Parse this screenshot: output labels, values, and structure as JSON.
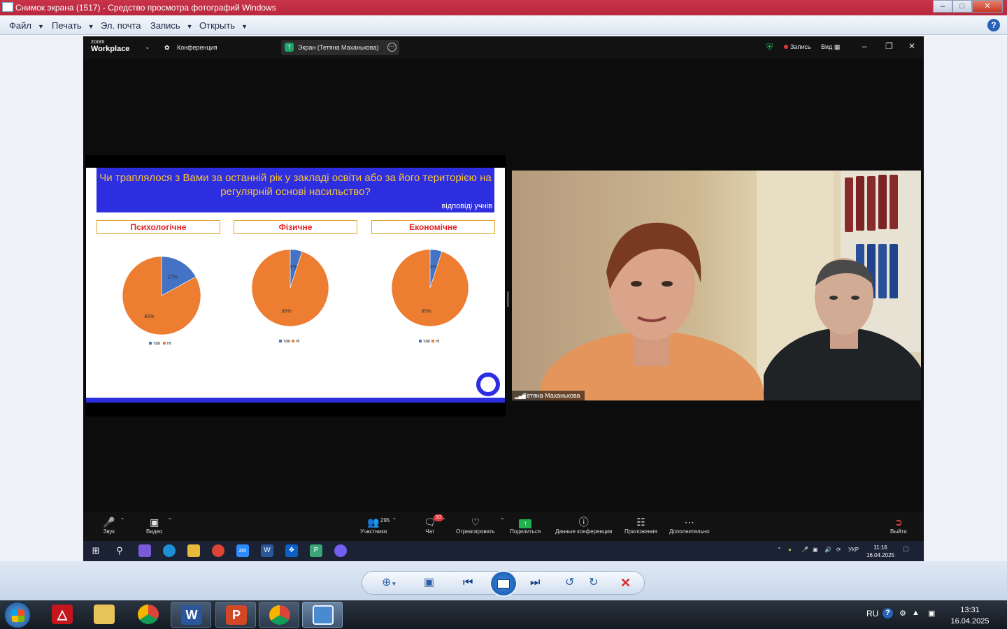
{
  "window": {
    "title": "Снимок экрана (1517) - Средство просмотра фотографий Windows",
    "controls": [
      "minimize",
      "maximize",
      "close"
    ]
  },
  "menu": {
    "items": [
      {
        "label": "Файл"
      },
      {
        "label": "Печать"
      },
      {
        "label": "Эл. почта"
      },
      {
        "label": "Запись"
      },
      {
        "label": "Открыть"
      }
    ],
    "help": "?"
  },
  "zoom": {
    "logo_small": "zoom",
    "logo_big": "Workplace",
    "conference_label": "Конференция",
    "share_badge": "T",
    "share_label": "Экран (Тетяна Маханькова)",
    "record_label": "Запись",
    "view_label": "Вид",
    "toolbar": {
      "audio": "Звук",
      "video": "Видео",
      "participants": "Участники",
      "participants_count": "295",
      "chat": "Чат",
      "chat_badge": "10",
      "react": "Отреагировать",
      "share": "Поделиться",
      "info": "Данные конференции",
      "apps": "Приложения",
      "more": "Дополнительно",
      "leave": "Выйти"
    },
    "video_name": "Тетяна Маханькова"
  },
  "slide": {
    "question": "Чи траплялося з Вами за останній рік у закладі освіти або за його територією на регулярній основі насильство?",
    "responders": "відповіді учнів",
    "colors": {
      "header": "#2d2ee0",
      "question_text": "#f5c23a",
      "category_text": "#e32323",
      "yes": "#4472c4",
      "no": "#ed7d31"
    },
    "legend_yes": "так",
    "legend_no": "ні"
  },
  "chart_data": [
    {
      "type": "pie",
      "title": "Психологічне",
      "categories": [
        "так",
        "ні"
      ],
      "values": [
        17,
        83
      ],
      "labels": [
        "17%",
        "83%"
      ]
    },
    {
      "type": "pie",
      "title": "Фізичне",
      "categories": [
        "так",
        "ні"
      ],
      "values": [
        5,
        95
      ],
      "labels": [
        "5%",
        "95%"
      ]
    },
    {
      "type": "pie",
      "title": "Економічне",
      "categories": [
        "так",
        "ні"
      ],
      "values": [
        5,
        95
      ],
      "labels": [
        "5%",
        "95%"
      ]
    }
  ],
  "remote_taskbar": {
    "lang": "УКР",
    "time": "11:16",
    "date": "16.04.2025"
  },
  "taskbar": {
    "lang": "RU",
    "time": "13:31",
    "date": "16.04.2025"
  }
}
